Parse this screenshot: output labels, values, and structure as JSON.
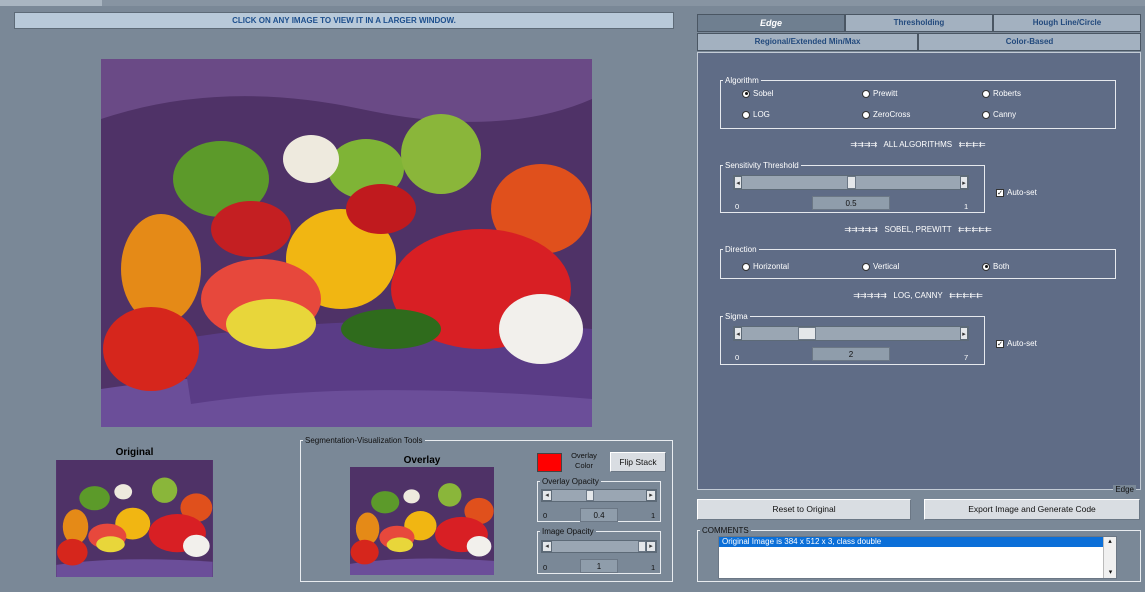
{
  "banner": "CLICK ON ANY IMAGE TO VIEW IT IN A LARGER WINDOW.",
  "left": {
    "original_caption": "Original",
    "seg_group_title": "Segmentation-Visualization Tools",
    "overlay_caption": "Overlay",
    "overlay_color_label_1": "Overlay",
    "overlay_color_label_2": "Color",
    "overlay_color": "#ff0000",
    "flip_stack_label": "Flip Stack",
    "overlay_opacity": {
      "title": "Overlay Opacity",
      "min": "0",
      "max": "1",
      "value": "0.4",
      "fraction": 0.4
    },
    "image_opacity": {
      "title": "Image Opacity",
      "min": "0",
      "max": "1",
      "value": "1",
      "fraction": 1
    }
  },
  "tabs": {
    "row1": [
      "Edge",
      "Thresholding",
      "Hough Line/Circle"
    ],
    "row2": [
      "Regional/Extended Min/Max",
      "Color-Based"
    ],
    "active": "Edge"
  },
  "edge": {
    "algorithm_title": "Algorithm",
    "algorithms": [
      {
        "label": "Sobel",
        "on": true
      },
      {
        "label": "Prewitt",
        "on": false
      },
      {
        "label": "Roberts",
        "on": false
      },
      {
        "label": "LOG",
        "on": false
      },
      {
        "label": "ZeroCross",
        "on": false
      },
      {
        "label": "Canny",
        "on": false
      }
    ],
    "note_all": "ALL ALGORITHMS",
    "note_sobel": "SOBEL, PREWITT",
    "note_log": "LOG, CANNY",
    "sensitivity": {
      "title": "Sensitivity Threshold",
      "min": "0",
      "max": "1",
      "value": "0.5",
      "fraction": 0.5,
      "autoset_label": "Auto-set"
    },
    "direction_title": "Direction",
    "directions": [
      {
        "label": "Horizontal",
        "on": false
      },
      {
        "label": "Vertical",
        "on": false
      },
      {
        "label": "Both",
        "on": true
      }
    ],
    "sigma": {
      "title": "Sigma",
      "min": "0",
      "max": "7",
      "value": "2",
      "fraction": 0.28,
      "autoset_label": "Auto-set"
    },
    "panel_footer": "Edge"
  },
  "buttons": {
    "reset": "Reset to Original",
    "export": "Export Image and Generate Code"
  },
  "comments": {
    "title": "COMMENTS",
    "line": "Original Image is 384 x 512 x 3, class double"
  }
}
